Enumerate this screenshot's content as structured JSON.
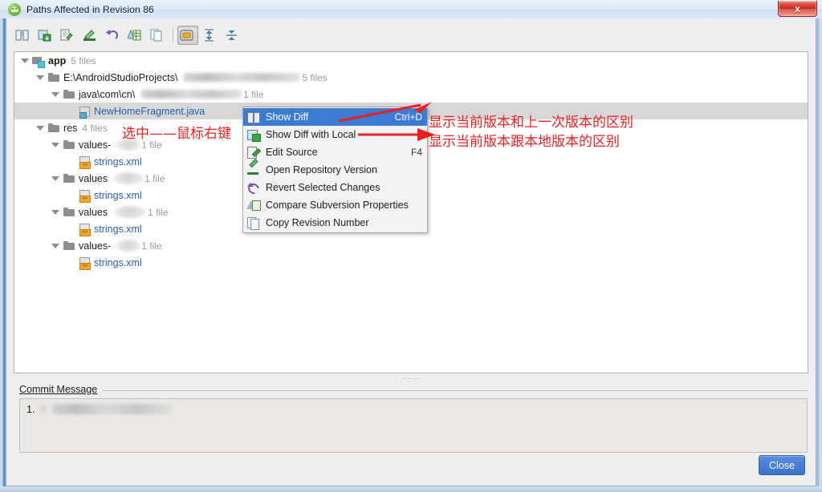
{
  "window": {
    "title": "Paths Affected in Revision 86",
    "app_icon": "android-studio-icon",
    "close_glyph": "x"
  },
  "toolbar": {
    "buttons": [
      {
        "name": "show-diff-icon",
        "tooltip": "Show Diff",
        "active": false
      },
      {
        "name": "show-diff-with-local-icon",
        "tooltip": "Show Diff with Local",
        "active": false
      },
      {
        "name": "edit-source-icon",
        "tooltip": "Edit Source",
        "active": false
      },
      {
        "name": "open-repository-version-icon",
        "tooltip": "Open Repository Version",
        "active": false
      },
      {
        "name": "revert-icon",
        "tooltip": "Revert Selected Changes",
        "active": false
      },
      {
        "name": "compare-properties-icon",
        "tooltip": "Compare Subversion Properties",
        "active": false
      },
      {
        "name": "copy-revision-number-icon",
        "tooltip": "Copy Revision Number",
        "active": false
      },
      {
        "name": "group-by-directory-icon",
        "tooltip": "Group by Directory",
        "active": true
      },
      {
        "name": "expand-all-icon",
        "tooltip": "Expand All",
        "active": false
      },
      {
        "name": "collapse-all-icon",
        "tooltip": "Collapse All",
        "active": false
      }
    ]
  },
  "tree": {
    "rows": [
      {
        "indent": 0,
        "twisty": true,
        "icon": "module-folder-icon",
        "label": "app",
        "bold": true,
        "link": false,
        "count": "5 files",
        "redacted_after": false,
        "selected": false
      },
      {
        "indent": 1,
        "twisty": true,
        "icon": "folder-icon",
        "label": "E:\\AndroidStudioProjects\\",
        "bold": false,
        "link": false,
        "count": "5 files",
        "redacted_after": true,
        "selected": false
      },
      {
        "indent": 2,
        "twisty": true,
        "icon": "folder-icon",
        "label": "java\\com\\cn\\",
        "bold": false,
        "link": false,
        "count": "1 file",
        "redacted_after": true,
        "selected": false
      },
      {
        "indent": 3,
        "twisty": false,
        "icon": "java-file-icon",
        "label": "NewHomeFragment.java",
        "bold": false,
        "link": true,
        "count": "",
        "redacted_after": false,
        "selected": true
      },
      {
        "indent": 1,
        "twisty": true,
        "icon": "folder-icon",
        "label": "res",
        "bold": false,
        "link": false,
        "count": "4 files",
        "redacted_after": false,
        "selected": false
      },
      {
        "indent": 2,
        "twisty": true,
        "icon": "folder-icon",
        "label": "values-",
        "bold": false,
        "link": false,
        "count": "1 file",
        "redacted_after": true,
        "selected": false
      },
      {
        "indent": 3,
        "twisty": false,
        "icon": "xml-file-icon",
        "label": "strings.xml",
        "bold": false,
        "link": true,
        "count": "",
        "redacted_after": false,
        "selected": false
      },
      {
        "indent": 2,
        "twisty": true,
        "icon": "folder-icon",
        "label": "values",
        "bold": false,
        "link": false,
        "count": "1 file",
        "redacted_after": true,
        "selected": false
      },
      {
        "indent": 3,
        "twisty": false,
        "icon": "xml-file-icon",
        "label": "strings.xml",
        "bold": false,
        "link": true,
        "count": "",
        "redacted_after": false,
        "selected": false
      },
      {
        "indent": 2,
        "twisty": true,
        "icon": "folder-icon",
        "label": "values",
        "bold": false,
        "link": false,
        "count": "1 file",
        "redacted_after": true,
        "selected": false
      },
      {
        "indent": 3,
        "twisty": false,
        "icon": "xml-file-icon",
        "label": "strings.xml",
        "bold": false,
        "link": true,
        "count": "",
        "redacted_after": false,
        "selected": false
      },
      {
        "indent": 2,
        "twisty": true,
        "icon": "folder-icon",
        "label": "values-",
        "bold": false,
        "link": false,
        "count": "1 file",
        "redacted_after": true,
        "selected": false
      },
      {
        "indent": 3,
        "twisty": false,
        "icon": "xml-file-icon",
        "label": "strings.xml",
        "bold": false,
        "link": true,
        "count": "",
        "redacted_after": false,
        "selected": false
      }
    ]
  },
  "context_menu": {
    "items": [
      {
        "label": "Show Diff",
        "shortcut": "Ctrl+D",
        "icon": "show-diff-icon",
        "selected": true
      },
      {
        "label": "Show Diff with Local",
        "shortcut": "",
        "icon": "show-diff-with-local-icon",
        "selected": false
      },
      {
        "label": "Edit Source",
        "shortcut": "F4",
        "icon": "edit-source-icon",
        "selected": false
      },
      {
        "label": "Open Repository Version",
        "shortcut": "",
        "icon": "open-repository-version-icon",
        "selected": false
      },
      {
        "label": "Revert Selected Changes",
        "shortcut": "",
        "icon": "revert-icon",
        "selected": false
      },
      {
        "label": "Compare Subversion Properties",
        "shortcut": "",
        "icon": "compare-properties-icon",
        "selected": false
      },
      {
        "label": "Copy Revision Number",
        "shortcut": "",
        "icon": "copy-revision-number-icon",
        "selected": false
      }
    ]
  },
  "annotations": {
    "color": "#ee1f1f",
    "tree_note": "选中——鼠标右键",
    "note_show_diff": "显示当前版本和上一次版本的区别",
    "note_show_diff_local": "显示当前版本跟本地版本的区别"
  },
  "commit_message": {
    "label": "Commit Message",
    "item_number": "1.",
    "text_redacted": true
  },
  "footer": {
    "close_label": "Close"
  },
  "colors": {
    "menu_highlight": "#3d7cd4",
    "link_text": "#2a5db0",
    "annotation_red": "#ee1f1f",
    "selected_row": "#d7d7d7",
    "close_button": "#4a7fd4"
  }
}
